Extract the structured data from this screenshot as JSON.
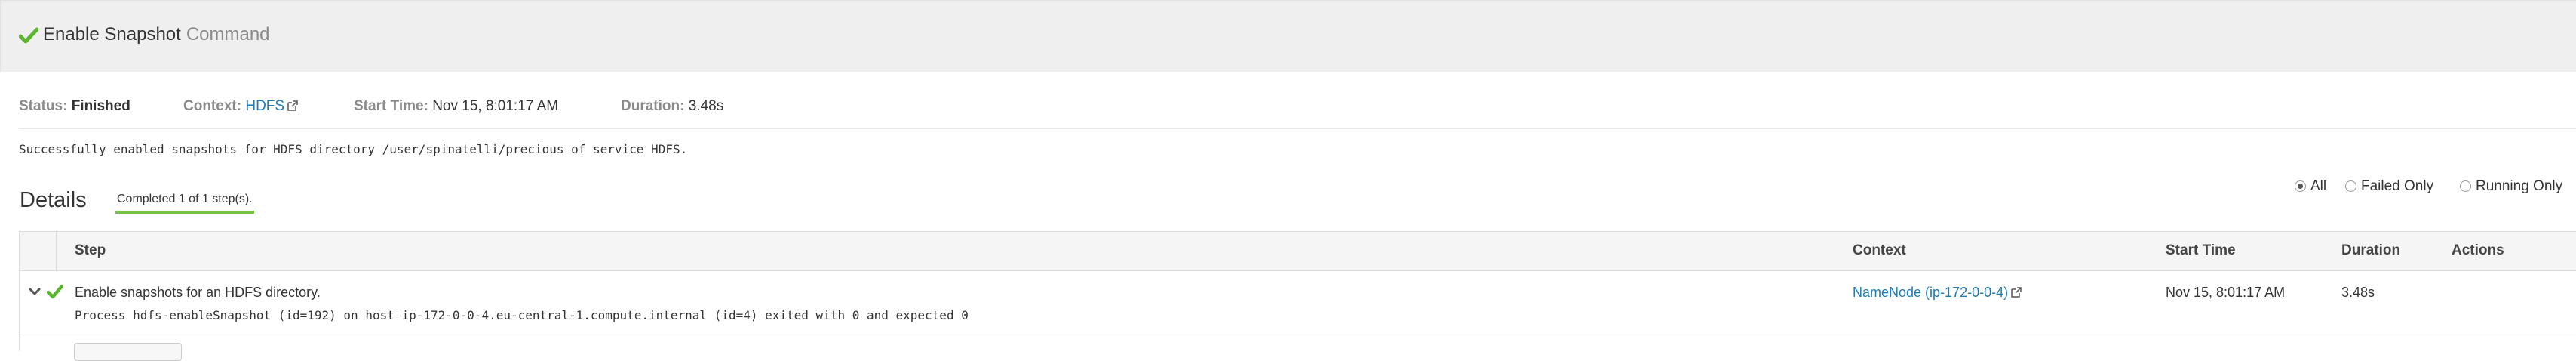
{
  "header": {
    "title": "Enable Snapshot",
    "subtitle": "Command",
    "check_icon": "check-icon",
    "accent_color": "#5cb531"
  },
  "status_bar": {
    "status_label": "Status:",
    "status_value": "Finished",
    "context_label": "Context:",
    "context_value": "HDFS",
    "start_label": "Start Time:",
    "start_value": "Nov 15, 8:01:17 AM",
    "duration_label": "Duration:",
    "duration_value": "3.48s",
    "external_icon": "external-link-icon"
  },
  "message": "Successfully enabled snapshots for HDFS directory /user/spinatelli/precious of service HDFS.",
  "details": {
    "title": "Details",
    "progress_text": "Completed 1 of 1 step(s).",
    "progress_color": "#76c043",
    "filters": [
      {
        "label": "All",
        "selected": true
      },
      {
        "label": "Failed Only",
        "selected": false
      },
      {
        "label": "Running Only",
        "selected": false
      }
    ]
  },
  "table": {
    "columns": [
      "Step",
      "Context",
      "Start Time",
      "Duration",
      "Actions"
    ],
    "rows": [
      {
        "step_title": "Enable snapshots for an HDFS directory.",
        "step_detail": "Process hdfs-enableSnapshot (id=192) on host ip-172-0-0-4.eu-central-1.compute.internal (id=4) exited with 0 and expected 0",
        "context": "NameNode (ip-172-0-0-4)",
        "start_time": "Nov 15, 8:01:17 AM",
        "duration": "3.48s",
        "actions": ""
      }
    ]
  }
}
